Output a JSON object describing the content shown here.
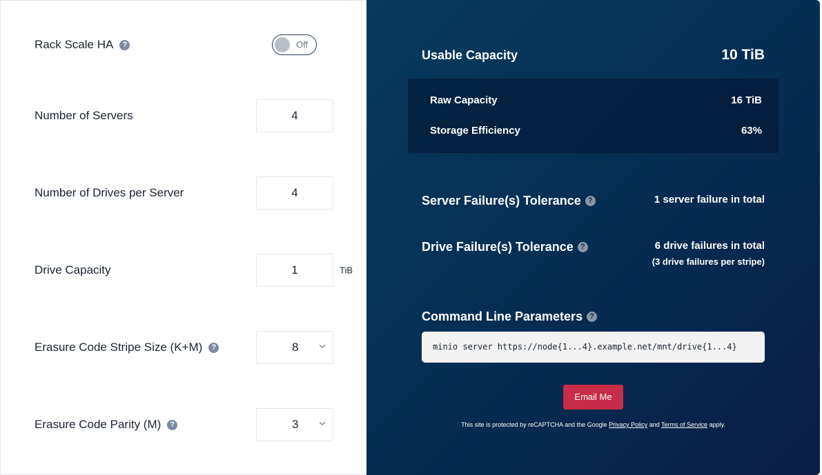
{
  "form": {
    "rack_scale_ha": {
      "label": "Rack Scale HA",
      "help": "?",
      "state": "Off"
    },
    "servers": {
      "label": "Number of Servers",
      "help": "",
      "value": "4"
    },
    "drives": {
      "label": "Number of Drives per Server",
      "value": "4"
    },
    "drive_capacity": {
      "label": "Drive Capacity",
      "value": "1",
      "unit": "TiB"
    },
    "stripe_size": {
      "label": "Erasure Code Stripe Size (K+M)",
      "help": "?",
      "value": "8"
    },
    "parity": {
      "label": "Erasure Code Parity (M)",
      "help": "?",
      "value": "3"
    }
  },
  "results": {
    "usable_label": "Usable Capacity",
    "usable_value": "10 TiB",
    "raw_label": "Raw Capacity",
    "raw_value": "16 TiB",
    "efficiency_label": "Storage Efficiency",
    "efficiency_value": "63%",
    "server_tol_label": "Server Failure(s) Tolerance",
    "server_tol_help": "?",
    "server_tol_value": "1 server failure in total",
    "drive_tol_label": "Drive Failure(s) Tolerance",
    "drive_tol_help": "?",
    "drive_tol_value": "6 drive failures in total",
    "drive_tol_sub": "(3 drive failures per stripe)",
    "cmd_label": "Command Line Parameters",
    "cmd_help": "?",
    "cmd_value": "minio server https://node{1...4}.example.net/mnt/drive{1...4}",
    "email_button": "Email Me"
  },
  "recaptcha": {
    "prefix": "This site is protected by reCAPTCHA and the Google ",
    "privacy": "Privacy Policy",
    "and": " and ",
    "terms": "Terms of Service",
    "suffix": " apply."
  },
  "colors": {
    "accent_button": "#c72c48",
    "panel_dark": "#052f54"
  }
}
